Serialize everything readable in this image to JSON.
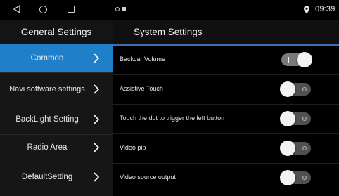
{
  "status_bar": {
    "time": "09:39",
    "icons": [
      "back-icon",
      "home-icon",
      "recents-icon",
      "notification-circle-icon",
      "notification-square-icon",
      "location-icon"
    ]
  },
  "header": {
    "left_title": "General Settings",
    "right_title": "System Settings",
    "accent_color": "#3a6fb5"
  },
  "sidebar": {
    "active_color": "#1f7fc9",
    "items": [
      {
        "label": "Common",
        "active": true
      },
      {
        "label": "Navi software settings",
        "active": false
      },
      {
        "label": "BackLight Setting",
        "active": false
      },
      {
        "label": "Radio Area",
        "active": false
      },
      {
        "label": "DefaultSetting",
        "active": false
      }
    ]
  },
  "settings": [
    {
      "label": "Backcar Volume",
      "on": true
    },
    {
      "label": "Assistive Touch",
      "on": false
    },
    {
      "label": "Touch the dot to trigger the left button",
      "on": false
    },
    {
      "label": "Video pip",
      "on": false
    },
    {
      "label": "Video source output",
      "on": false
    }
  ]
}
